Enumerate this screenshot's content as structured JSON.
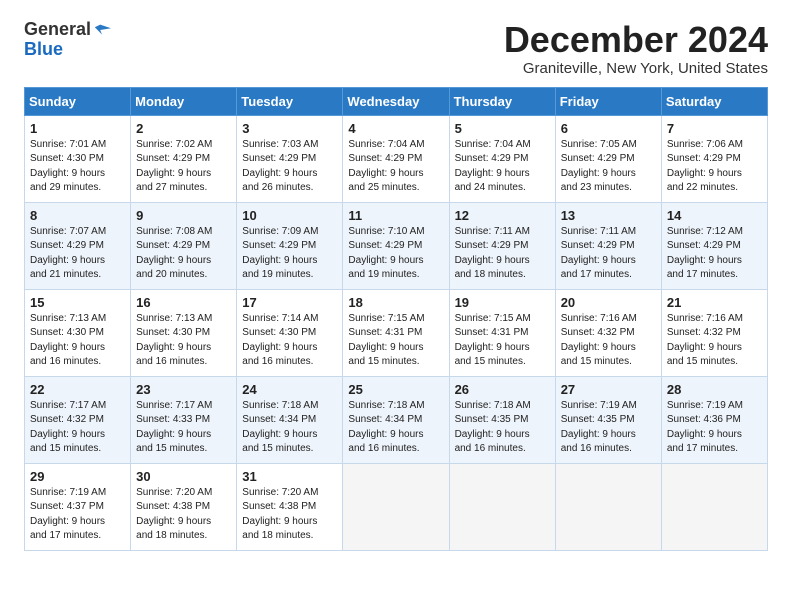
{
  "logo": {
    "general": "General",
    "blue": "Blue"
  },
  "title": "December 2024",
  "location": "Graniteville, New York, United States",
  "days_of_week": [
    "Sunday",
    "Monday",
    "Tuesday",
    "Wednesday",
    "Thursday",
    "Friday",
    "Saturday"
  ],
  "weeks": [
    [
      {
        "day": "1",
        "info": "Sunrise: 7:01 AM\nSunset: 4:30 PM\nDaylight: 9 hours\nand 29 minutes."
      },
      {
        "day": "2",
        "info": "Sunrise: 7:02 AM\nSunset: 4:29 PM\nDaylight: 9 hours\nand 27 minutes."
      },
      {
        "day": "3",
        "info": "Sunrise: 7:03 AM\nSunset: 4:29 PM\nDaylight: 9 hours\nand 26 minutes."
      },
      {
        "day": "4",
        "info": "Sunrise: 7:04 AM\nSunset: 4:29 PM\nDaylight: 9 hours\nand 25 minutes."
      },
      {
        "day": "5",
        "info": "Sunrise: 7:04 AM\nSunset: 4:29 PM\nDaylight: 9 hours\nand 24 minutes."
      },
      {
        "day": "6",
        "info": "Sunrise: 7:05 AM\nSunset: 4:29 PM\nDaylight: 9 hours\nand 23 minutes."
      },
      {
        "day": "7",
        "info": "Sunrise: 7:06 AM\nSunset: 4:29 PM\nDaylight: 9 hours\nand 22 minutes."
      }
    ],
    [
      {
        "day": "8",
        "info": "Sunrise: 7:07 AM\nSunset: 4:29 PM\nDaylight: 9 hours\nand 21 minutes."
      },
      {
        "day": "9",
        "info": "Sunrise: 7:08 AM\nSunset: 4:29 PM\nDaylight: 9 hours\nand 20 minutes."
      },
      {
        "day": "10",
        "info": "Sunrise: 7:09 AM\nSunset: 4:29 PM\nDaylight: 9 hours\nand 19 minutes."
      },
      {
        "day": "11",
        "info": "Sunrise: 7:10 AM\nSunset: 4:29 PM\nDaylight: 9 hours\nand 19 minutes."
      },
      {
        "day": "12",
        "info": "Sunrise: 7:11 AM\nSunset: 4:29 PM\nDaylight: 9 hours\nand 18 minutes."
      },
      {
        "day": "13",
        "info": "Sunrise: 7:11 AM\nSunset: 4:29 PM\nDaylight: 9 hours\nand 17 minutes."
      },
      {
        "day": "14",
        "info": "Sunrise: 7:12 AM\nSunset: 4:29 PM\nDaylight: 9 hours\nand 17 minutes."
      }
    ],
    [
      {
        "day": "15",
        "info": "Sunrise: 7:13 AM\nSunset: 4:30 PM\nDaylight: 9 hours\nand 16 minutes."
      },
      {
        "day": "16",
        "info": "Sunrise: 7:13 AM\nSunset: 4:30 PM\nDaylight: 9 hours\nand 16 minutes."
      },
      {
        "day": "17",
        "info": "Sunrise: 7:14 AM\nSunset: 4:30 PM\nDaylight: 9 hours\nand 16 minutes."
      },
      {
        "day": "18",
        "info": "Sunrise: 7:15 AM\nSunset: 4:31 PM\nDaylight: 9 hours\nand 15 minutes."
      },
      {
        "day": "19",
        "info": "Sunrise: 7:15 AM\nSunset: 4:31 PM\nDaylight: 9 hours\nand 15 minutes."
      },
      {
        "day": "20",
        "info": "Sunrise: 7:16 AM\nSunset: 4:32 PM\nDaylight: 9 hours\nand 15 minutes."
      },
      {
        "day": "21",
        "info": "Sunrise: 7:16 AM\nSunset: 4:32 PM\nDaylight: 9 hours\nand 15 minutes."
      }
    ],
    [
      {
        "day": "22",
        "info": "Sunrise: 7:17 AM\nSunset: 4:32 PM\nDaylight: 9 hours\nand 15 minutes."
      },
      {
        "day": "23",
        "info": "Sunrise: 7:17 AM\nSunset: 4:33 PM\nDaylight: 9 hours\nand 15 minutes."
      },
      {
        "day": "24",
        "info": "Sunrise: 7:18 AM\nSunset: 4:34 PM\nDaylight: 9 hours\nand 15 minutes."
      },
      {
        "day": "25",
        "info": "Sunrise: 7:18 AM\nSunset: 4:34 PM\nDaylight: 9 hours\nand 16 minutes."
      },
      {
        "day": "26",
        "info": "Sunrise: 7:18 AM\nSunset: 4:35 PM\nDaylight: 9 hours\nand 16 minutes."
      },
      {
        "day": "27",
        "info": "Sunrise: 7:19 AM\nSunset: 4:35 PM\nDaylight: 9 hours\nand 16 minutes."
      },
      {
        "day": "28",
        "info": "Sunrise: 7:19 AM\nSunset: 4:36 PM\nDaylight: 9 hours\nand 17 minutes."
      }
    ],
    [
      {
        "day": "29",
        "info": "Sunrise: 7:19 AM\nSunset: 4:37 PM\nDaylight: 9 hours\nand 17 minutes."
      },
      {
        "day": "30",
        "info": "Sunrise: 7:20 AM\nSunset: 4:38 PM\nDaylight: 9 hours\nand 18 minutes."
      },
      {
        "day": "31",
        "info": "Sunrise: 7:20 AM\nSunset: 4:38 PM\nDaylight: 9 hours\nand 18 minutes."
      },
      null,
      null,
      null,
      null
    ]
  ]
}
